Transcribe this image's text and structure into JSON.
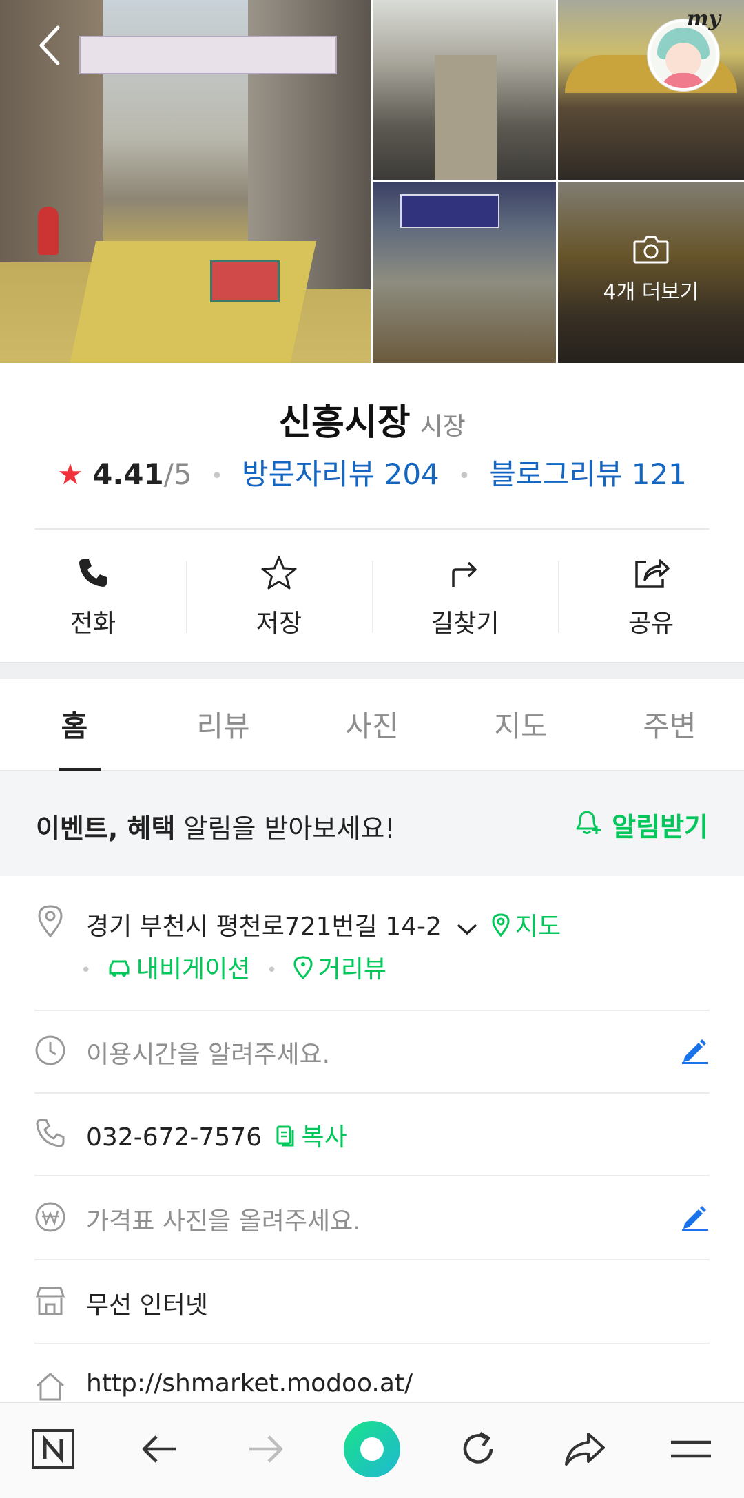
{
  "header": {
    "back_icon": "chevron-left-icon",
    "my_label": "my",
    "more_photos_label": "4개 더보기"
  },
  "place": {
    "name": "신흥시장",
    "category": "시장",
    "rating_star": "★",
    "rating_score": "4.41",
    "rating_max": "/5",
    "visitor_review_label": "방문자리뷰 204",
    "blog_review_label": "블로그리뷰 121"
  },
  "actions": [
    {
      "label": "전화",
      "icon": "phone-icon"
    },
    {
      "label": "저장",
      "icon": "star-icon"
    },
    {
      "label": "길찾기",
      "icon": "directions-icon"
    },
    {
      "label": "공유",
      "icon": "share-icon"
    }
  ],
  "tabs": [
    {
      "label": "홈",
      "active": true
    },
    {
      "label": "리뷰",
      "active": false
    },
    {
      "label": "사진",
      "active": false
    },
    {
      "label": "지도",
      "active": false
    },
    {
      "label": "주변",
      "active": false
    }
  ],
  "event": {
    "bold_text": "이벤트, 혜택",
    "text": " 알림을 받아보세요!",
    "notify_label": "알림받기"
  },
  "info": {
    "address": "경기 부천시 평천로721번길 14-2",
    "map_link": "지도",
    "navigation_link": "내비게이션",
    "streetview_link": "거리뷰",
    "hours_placeholder": "이용시간을 알려주세요.",
    "phone": "032-672-7576",
    "copy_label": "복사",
    "price_placeholder": "가격표 사진을 올려주세요.",
    "amenity": "무선 인터넷",
    "website": "http://shmarket.modoo.at/"
  },
  "colors": {
    "accent_green": "#03c75a",
    "link_blue": "#1466c0",
    "rating_red": "#f0313a",
    "edit_blue": "#1a73e8"
  },
  "bottom_nav": [
    {
      "icon": "naver-n-icon"
    },
    {
      "icon": "back-arrow-icon"
    },
    {
      "icon": "forward-arrow-icon"
    },
    {
      "icon": "green-dot-home-icon"
    },
    {
      "icon": "refresh-icon"
    },
    {
      "icon": "share-arrow-icon"
    },
    {
      "icon": "menu-icon"
    }
  ]
}
